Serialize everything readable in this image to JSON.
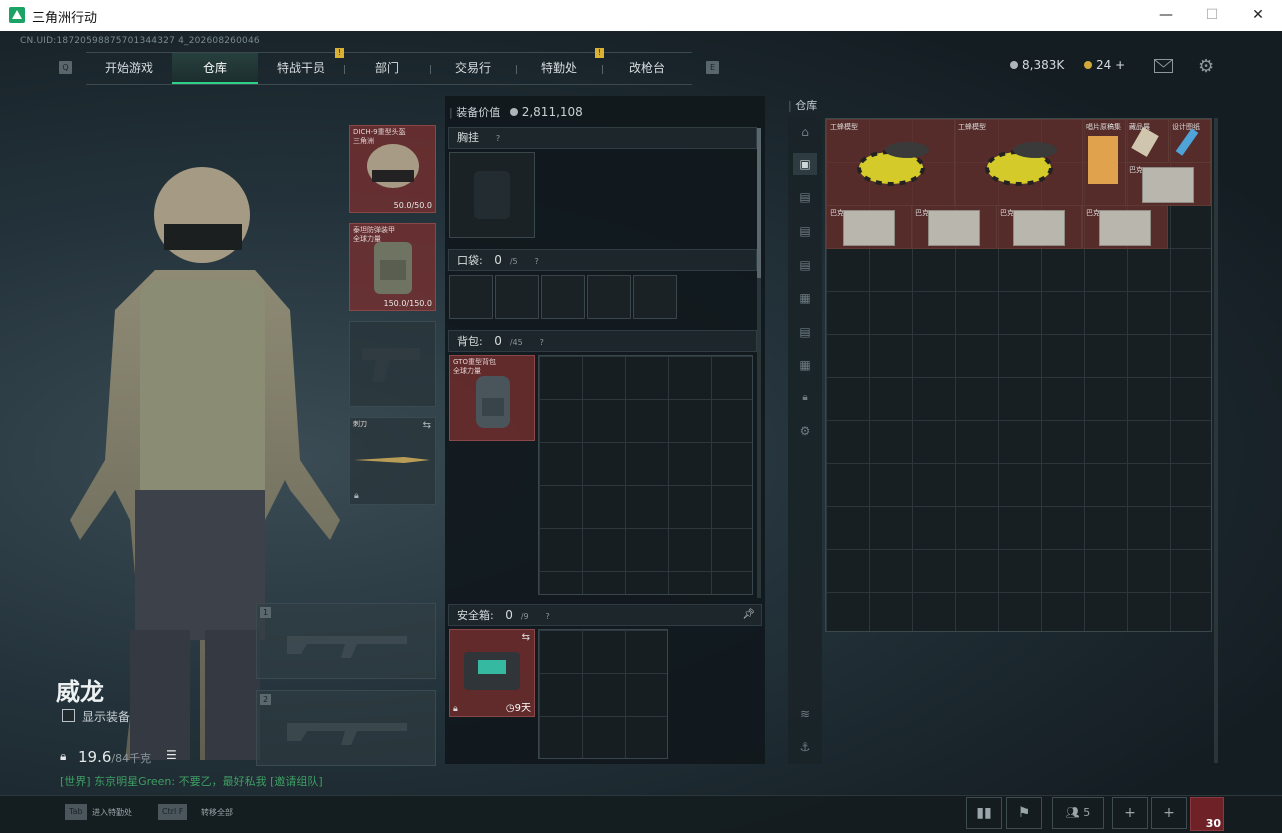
{
  "window": {
    "title": "三角洲行动",
    "minimize": "—",
    "maximize": "☐",
    "close": "✕"
  },
  "uid": "CN.UID:18720598875701344327 4_202608260046",
  "nav": {
    "left_key": "Q",
    "right_key": "E",
    "tabs": [
      {
        "label": "开始游戏",
        "active": false,
        "badge": ""
      },
      {
        "label": "仓库",
        "active": true,
        "badge": ""
      },
      {
        "label": "特战干员",
        "active": false,
        "badge": "!"
      },
      {
        "label": "部门",
        "active": false,
        "badge": ""
      },
      {
        "label": "交易行",
        "active": false,
        "badge": ""
      },
      {
        "label": "特勤处",
        "active": false,
        "badge": "!"
      },
      {
        "label": "改枪台",
        "active": false,
        "badge": ""
      }
    ]
  },
  "currency": {
    "silver": "8,383K",
    "gold": "24",
    "plus": "+",
    "silver_color": "#aeb6ba",
    "gold_color": "#d1a93a"
  },
  "character": {
    "name": "威龙",
    "show_equipment": "显示装备",
    "weight": "19.6",
    "weight_max": "/84千克"
  },
  "chat": {
    "text": "[世界] 东京明星Green: 不要乙，最好私我 [邀请组队]"
  },
  "equipment": {
    "helmet": {
      "name": "DICH-9重型头盔\n三角洲",
      "durability": "50.0/50.0"
    },
    "armor": {
      "name": "泰坦防弹装甲\n全球力量",
      "durability": "150.0/150.0"
    },
    "melee": {
      "name": "刺刀"
    },
    "weapon_slot_1": "1",
    "weapon_slot_2": "2"
  },
  "loadout": {
    "value_label": "装备价值",
    "value": "2,811,108",
    "chest_rig": {
      "label": "胸挂"
    },
    "pockets": {
      "label": "口袋:",
      "count": "0",
      "max": "/5"
    },
    "backpack": {
      "label": "背包:",
      "count": "0",
      "max": "/45",
      "item_name": "GTO重型背包\n全球力量"
    },
    "safe_box": {
      "label": "安全箱:",
      "count": "0",
      "max": "/9",
      "days": "9天"
    }
  },
  "warehouse": {
    "title": "仓库",
    "items": [
      {
        "name": "工蜂模型"
      },
      {
        "name": "工蜂模型"
      },
      {
        "name": "唱片原稿集"
      },
      {
        "name": "藏品展"
      },
      {
        "name": "设计图纸"
      },
      {
        "name": "巴克"
      },
      {
        "name": "巴克"
      },
      {
        "name": "巴克"
      },
      {
        "name": "巴克"
      },
      {
        "name": "巴克"
      }
    ]
  },
  "bottom": {
    "tab_key": "Tab",
    "tab_label": "进入特勤处",
    "ctrl_key": "Ctrl F",
    "ctrl_label": "转移全部",
    "friends_count": "5",
    "level": "30"
  },
  "icons": [
    "close-icon",
    "maximize-icon",
    "minimize-icon",
    "mail-icon",
    "settings-icon",
    "lock-icon",
    "list-icon",
    "swap-icon",
    "pin-icon",
    "clock-icon",
    "stats-icon",
    "flag-icon",
    "friends-icon",
    "plus-icon",
    "layers-icon",
    "anchor-icon"
  ],
  "colors": {
    "accent": "#2dd18a",
    "item_red": "#7a3a34",
    "badge": "#d9b233",
    "chat_green": "#3f9e63"
  }
}
